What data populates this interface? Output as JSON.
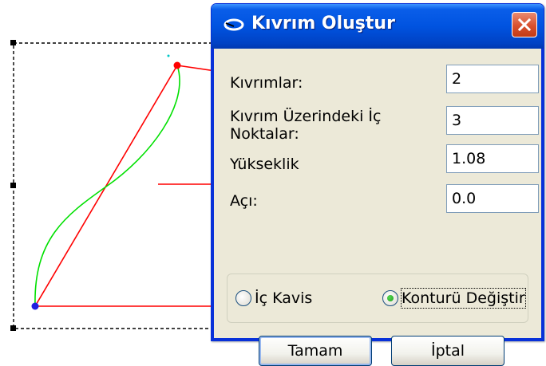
{
  "dialog": {
    "title": "Kıvrım Oluştur",
    "icon": "curve-icon",
    "close_icon": "close-icon",
    "fields": [
      {
        "label": "Kıvrımlar:",
        "value": "2"
      },
      {
        "label": "Kıvrım Üzerindeki İç\nNoktalar:",
        "value": "3"
      },
      {
        "label": "Yükseklik",
        "value": "1.08"
      },
      {
        "label": "Açı:",
        "value": "0.0"
      }
    ],
    "radio_options": [
      {
        "label": "İç Kavis",
        "selected": false
      },
      {
        "label": "Konturü Değiştir",
        "selected": true
      }
    ],
    "ok_label": "Tamam",
    "cancel_label": "İptal"
  },
  "colors": {
    "selection_line": "#ff0000",
    "curve": "#00e000",
    "title_bar": "#0053e0",
    "dialog_bg": "#ece9d8"
  }
}
